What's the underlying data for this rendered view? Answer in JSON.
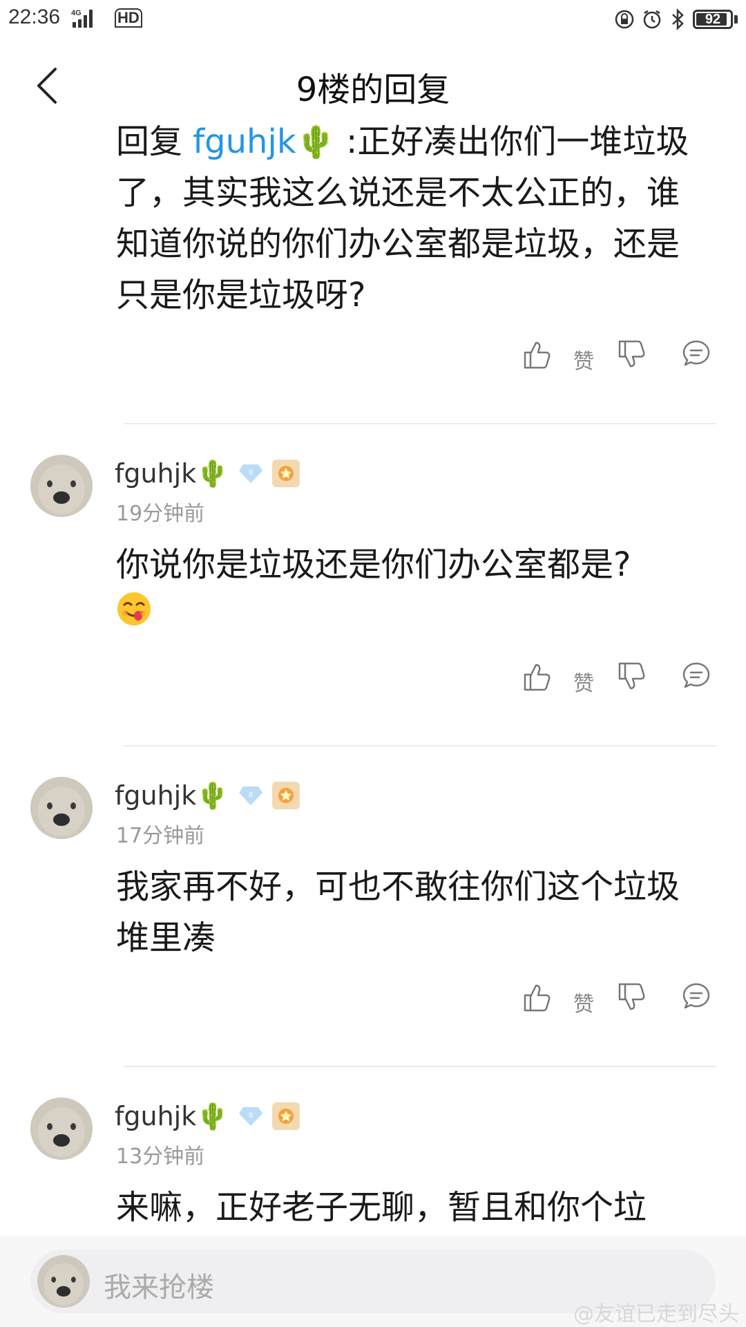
{
  "status_bar": {
    "time": "22:36",
    "network": "4G",
    "hd": "HD",
    "battery": "92"
  },
  "header": {
    "title": "9楼的回复"
  },
  "main_reply": {
    "prefix": "回复 ",
    "mention": "fguhjk",
    "emoji": "🌵",
    "text": " :正好凑出你们一堆垃圾了，其实我这么说还是不太公正的，谁知道你说的你们办公室都是垃圾，还是只是你是垃圾呀?"
  },
  "action": {
    "like_label": "赞"
  },
  "comments": [
    {
      "username": "fguhjk",
      "user_emoji": "🌵",
      "level": "8",
      "time": "19分钟前",
      "text": "你说你是垃圾还是你们办公室都是?"
    },
    {
      "username": "fguhjk",
      "user_emoji": "🌵",
      "level": "8",
      "time": "17分钟前",
      "text": "我家再不好，可也不敢往你们这个垃圾堆里凑"
    },
    {
      "username": "fguhjk",
      "user_emoji": "🌵",
      "level": "8",
      "time": "13分钟前",
      "text": "来嘛，正好老子无聊，暂且和你个垃"
    }
  ],
  "bottom": {
    "placeholder": "我来抢楼",
    "watermark": "@友谊已走到尽头"
  },
  "colors": {
    "mention": "#2196e6",
    "time": "#999999",
    "divider": "#ececec"
  }
}
